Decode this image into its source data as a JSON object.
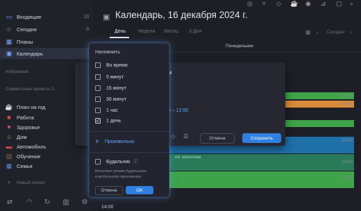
{
  "sidebar": {
    "items": [
      {
        "label": "Входящие",
        "count": "13",
        "icon": "inbox-icon",
        "color": "#7aa7ff"
      },
      {
        "label": "Сегодня",
        "count": "3",
        "icon": "star-icon",
        "color": "#7aa7ff"
      },
      {
        "label": "Планы",
        "count": "",
        "icon": "calendar-plans-icon",
        "color": "#7aa7ff"
      },
      {
        "label": "Календарь",
        "count": "",
        "icon": "calendar-icon",
        "color": "#7aa7ff"
      }
    ],
    "section_favorites": "Избранное",
    "section_shared": "Совместные проекты 3",
    "projects": [
      {
        "label": "План на год",
        "icon": "coffee-icon",
        "color": "#e6a54a"
      },
      {
        "label": "Работа",
        "icon": "briefcase-icon",
        "color": "#d94a4a"
      },
      {
        "label": "Здоровье",
        "icon": "heart-icon",
        "color": "#e05565"
      },
      {
        "label": "Дом",
        "icon": "home-icon",
        "color": "#e0a03a"
      },
      {
        "label": "Автомобиль",
        "icon": "car-icon",
        "color": "#d94a4a"
      },
      {
        "label": "Обучение",
        "icon": "book-icon",
        "color": "#8a6a4a"
      },
      {
        "label": "Семья",
        "icon": "family-icon",
        "color": "#5a8ad9"
      }
    ],
    "new_project": "Новый проект"
  },
  "header": {
    "title": "Календарь, 16 декабря 2024 г.",
    "tabs": [
      "День",
      "Неделя",
      "Месяц",
      "3 Дня"
    ],
    "today": "Сегодня",
    "weekday": "Понедельник"
  },
  "calendar": {
    "time_labels": [
      "07:30",
      "08:00",
      "10:00",
      "11:00",
      "12:00"
    ],
    "event_hint": "ий закончим",
    "last_time": "14:00"
  },
  "card": {
    "title_fragment": "м",
    "time": "0 – 12:00",
    "cancel": "Отмена",
    "save": "Сохранить"
  },
  "popup": {
    "header": "Напомнить",
    "options": [
      {
        "label": "Во время",
        "checked": false
      },
      {
        "label": "5 минут",
        "checked": false
      },
      {
        "label": "15 минут",
        "checked": false
      },
      {
        "label": "30 минут",
        "checked": false
      },
      {
        "label": "1 час",
        "checked": false
      },
      {
        "label": "1 день",
        "checked": true
      }
    ],
    "custom": "Произвольно",
    "alarm_label": "Будильник",
    "alarm_desc1": "Включает режим будильника",
    "alarm_desc2": "в мобильном приложении",
    "cancel": "Отмена",
    "ok": "OK"
  },
  "colors": {
    "accent": "#3a8ae0",
    "green": "#3fa34a",
    "orange": "#d98a3a",
    "blue": "#1f6fa8",
    "teal": "#2a7a5a"
  }
}
